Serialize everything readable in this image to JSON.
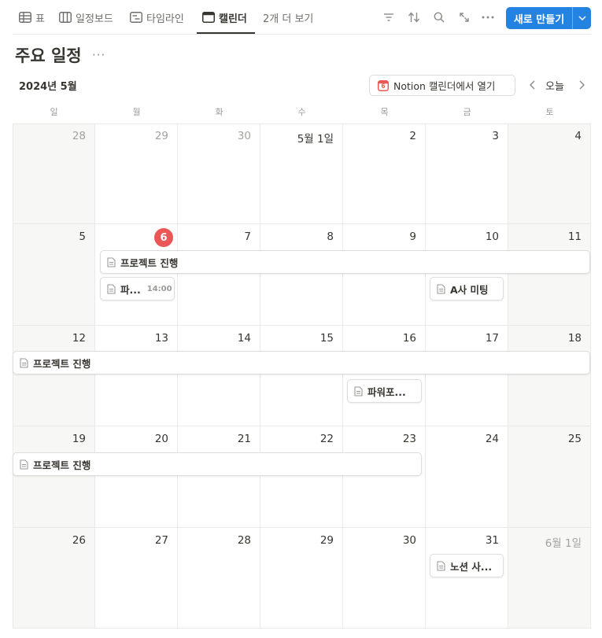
{
  "toolbar": {
    "tabs": [
      {
        "label": "표",
        "icon": "table-icon"
      },
      {
        "label": "일정보드",
        "icon": "board-icon"
      },
      {
        "label": "타임라인",
        "icon": "timeline-icon"
      },
      {
        "label": "캘린더",
        "icon": "calendar-icon",
        "active": true
      }
    ],
    "more_views": "2개 더 보기",
    "new_button": "새로 만들기"
  },
  "page": {
    "title": "주요 일정",
    "more": "···"
  },
  "calendar": {
    "month_label": "2024년 5월",
    "open_in_notion": "Notion 캘린더에서 열기",
    "calendar_badge": "6",
    "today_label": "오늘",
    "weekdays": [
      "일",
      "월",
      "화",
      "수",
      "목",
      "금",
      "토"
    ],
    "days": [
      "28",
      "29",
      "30",
      "5월 1일",
      "2",
      "3",
      "4",
      "5",
      "6",
      "7",
      "8",
      "9",
      "10",
      "11",
      "12",
      "13",
      "14",
      "15",
      "16",
      "17",
      "18",
      "19",
      "20",
      "21",
      "22",
      "23",
      "24",
      "25",
      "26",
      "27",
      "28",
      "29",
      "30",
      "31",
      "6월 1일"
    ],
    "today": "6",
    "events": {
      "project_week2": "프로젝트 진행",
      "powerpoint_short": "파...",
      "powerpoint_time": "14:00",
      "a_company_meeting": "A사 미팅",
      "project_week3": "프로젝트 진행",
      "powerpoint_week3": "파워포...",
      "project_week4": "프로젝트 진행",
      "notion_study": "노션 사..."
    }
  },
  "colors": {
    "accent": "#2383e2",
    "today": "#eb5757",
    "weekend_bg": "#f7f7f5",
    "border": "#e9e9e7"
  }
}
